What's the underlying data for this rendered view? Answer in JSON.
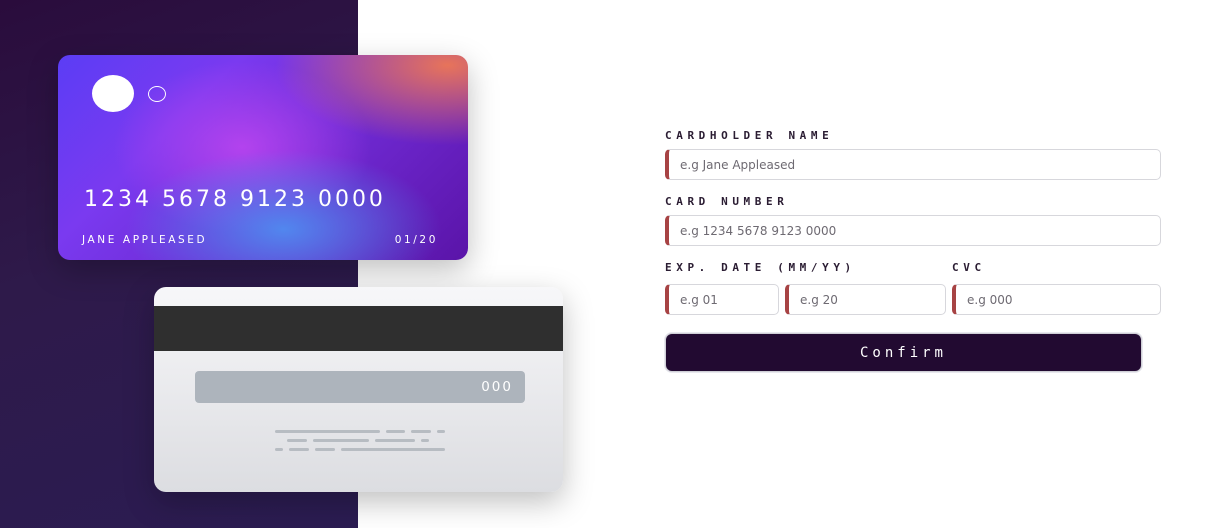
{
  "card_front": {
    "number": "1234 5678 9123 0000",
    "holder": "JANE APPLEASED",
    "expiry": "01/20"
  },
  "card_back": {
    "cvc": "000"
  },
  "form": {
    "cardholder_label": "CARDHOLDER NAME",
    "cardholder_placeholder": "e.g Jane Appleased",
    "number_label": "CARD NUMBER",
    "number_placeholder": "e.g 1234 5678 9123 0000",
    "expiry_label": "EXP. DATE (MM/YY)",
    "month_placeholder": "e.g 01",
    "year_placeholder": "e.g 20",
    "cvc_label": "CVC",
    "cvc_placeholder": "e.g 000",
    "confirm_label": "Confirm"
  },
  "colors": {
    "dark_panel": "#2a0c3c",
    "input_accent": "#a74344",
    "button_bg": "#220a31"
  }
}
